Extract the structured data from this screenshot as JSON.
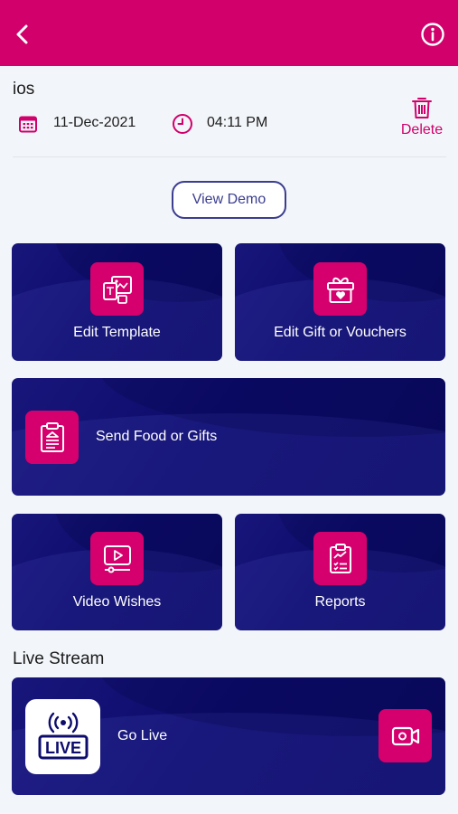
{
  "header": {
    "back_icon": "chevron-left-icon",
    "info_icon": "info-icon",
    "color": "#d1006b"
  },
  "event": {
    "title": "ios",
    "date": "11-Dec-2021",
    "time": "04:11 PM",
    "delete_label": "Delete"
  },
  "demo": {
    "label": "View Demo"
  },
  "tiles": {
    "edit_template": "Edit Template",
    "edit_gift": "Edit Gift or Vouchers",
    "send_food": "Send Food or Gifts",
    "video_wishes": "Video Wishes",
    "reports": "Reports"
  },
  "live": {
    "section_title": "Live Stream",
    "go_live": "Go Live",
    "logo_text": "LIVE"
  },
  "colors": {
    "accent": "#d1006b",
    "card": "#0d0c6c",
    "demo_border": "#3b3d8f"
  }
}
